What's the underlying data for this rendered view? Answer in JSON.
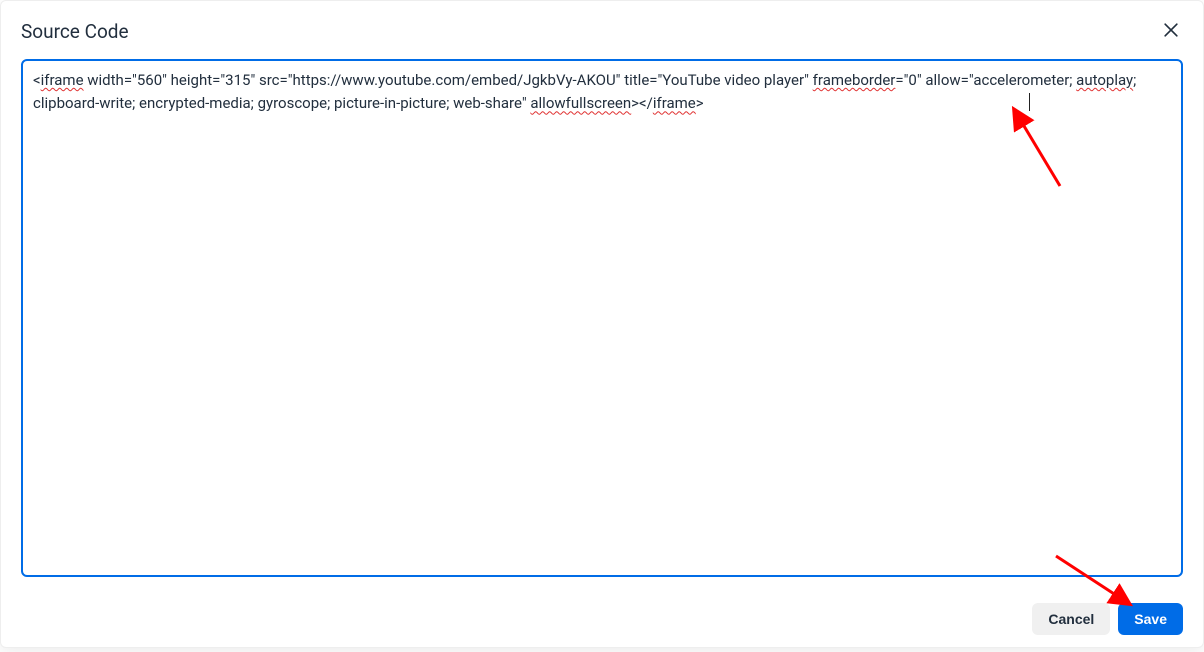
{
  "dialog": {
    "title": "Source Code",
    "code_content": "<iframe width=\"560\" height=\"315\" src=\"https://www.youtube.com/embed/JgkbVy-AKOU\" title=\"YouTube video player\" frameborder=\"0\" allow=\"accelerometer; autoplay; clipboard-write; encrypted-media; gyroscope; picture-in-picture; web-share\" allowfullscreen></iframe>",
    "cancel_label": "Cancel",
    "save_label": "Save"
  },
  "annotations": {
    "arrows": [
      {
        "points_to": "end-of-code-text"
      },
      {
        "points_to": "save-button"
      }
    ]
  },
  "colors": {
    "primary": "#006ce7",
    "annotation_red": "#ff0000"
  }
}
